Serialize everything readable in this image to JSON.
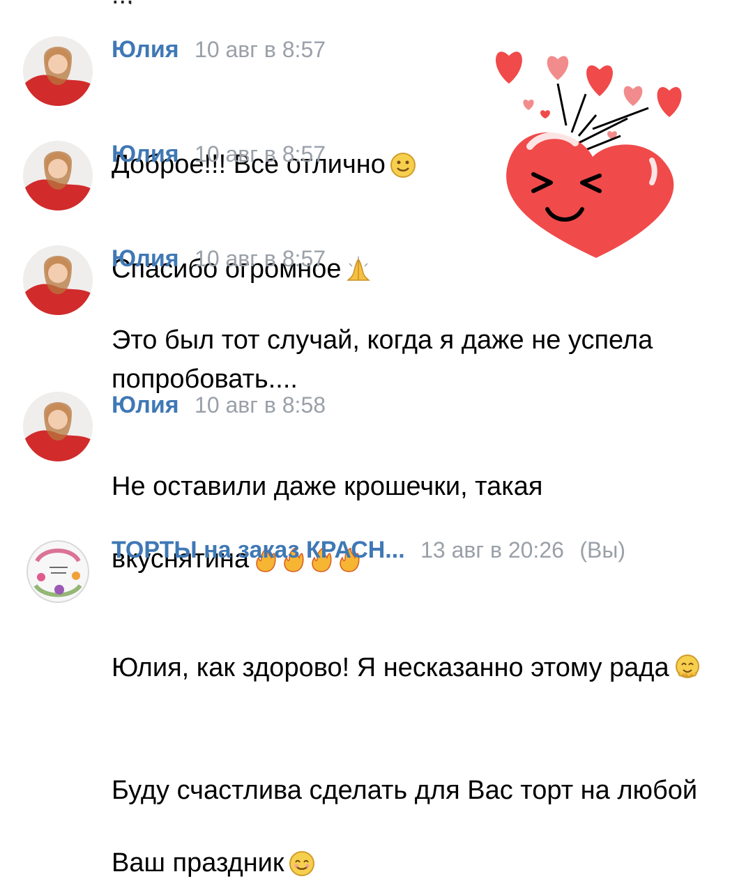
{
  "messages": [
    {
      "author": "Юлия",
      "time": "10 авг в 8:57",
      "text": "Доброе!!! Все отлично",
      "emoji": [
        "slightly-smiling-face"
      ]
    },
    {
      "author": "Юлия",
      "time": "10 авг в 8:57",
      "text": "Спасибо огромное",
      "emoji": [
        "folded-hands"
      ]
    },
    {
      "author": "Юлия",
      "time": "10 авг в 8:57",
      "text": "Это был тот случай, когда я даже не успела попробовать....",
      "emoji": []
    },
    {
      "author": "Юлия",
      "time": "10 авг в 8:58",
      "text": "Не оставили даже крошечки, такая вкуснятина",
      "emoji": [
        "fire",
        "fire",
        "fire",
        "fire"
      ]
    },
    {
      "author": "ТОРТЫ на заказ КРАСН...",
      "time": "13 авг в 20:26",
      "you": "(Вы)",
      "text_1": "Юлия, как здорово! Я несказанно этому рада",
      "text_2": "Буду счастлива сделать для Вас торт на любой Ваш праздник",
      "emoji": [
        "hugging-face",
        "smiling-face"
      ]
    }
  ],
  "sticker": {
    "name": "heart-sticker"
  },
  "colors": {
    "name": "#3f78b5",
    "time": "#9aa0a8",
    "heart": "#f04a4a"
  }
}
